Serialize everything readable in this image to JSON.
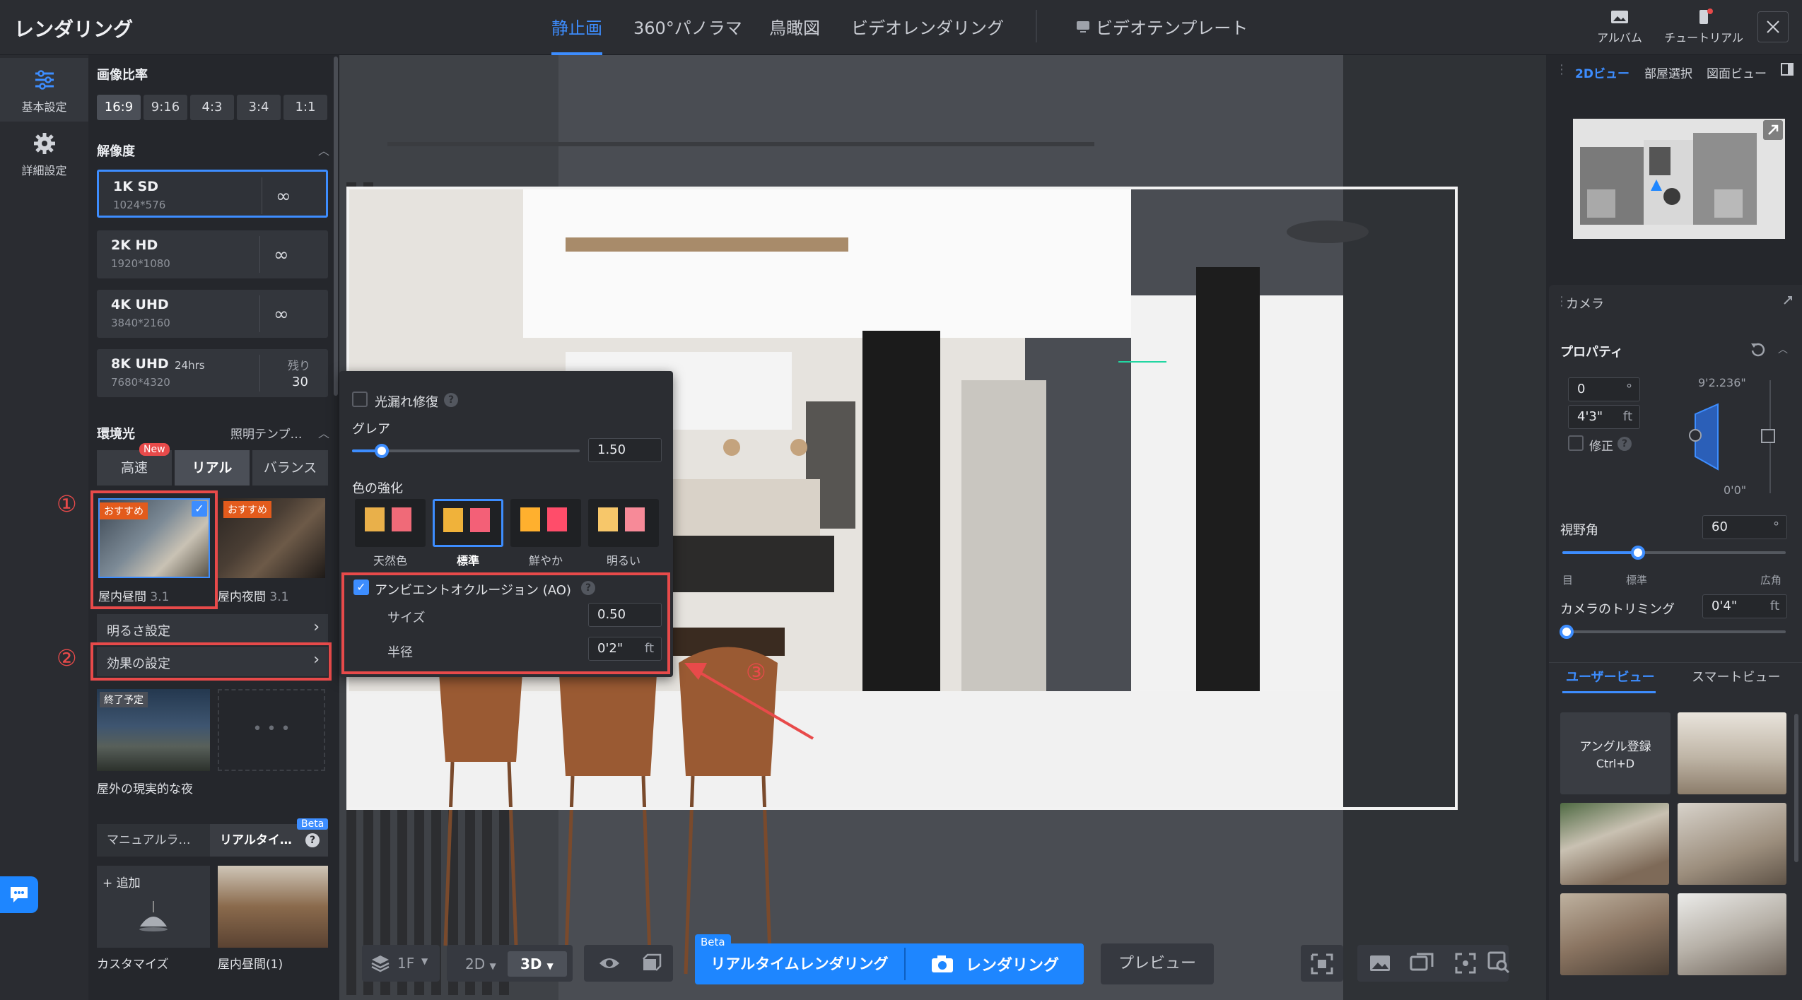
{
  "app": {
    "title": "レンダリング"
  },
  "top_tabs": [
    {
      "label": "静止画",
      "active": true
    },
    {
      "label": "360°パノラマ"
    },
    {
      "label": "鳥瞰図"
    },
    {
      "label": "ビデオレンダリング"
    },
    {
      "label": "ビデオテンプレート"
    }
  ],
  "top_right": {
    "album": "アルバム",
    "tutorial": "チュートリアル"
  },
  "left_nav": {
    "basic": "基本設定",
    "advanced": "詳細設定"
  },
  "aspect": {
    "title": "画像比率",
    "options": [
      "16:9",
      "9:16",
      "4:3",
      "3:4",
      "1:1"
    ],
    "selected": "16:9"
  },
  "resolution": {
    "title": "解像度",
    "options": [
      {
        "name": "1K SD",
        "size": "1024*576",
        "right": "∞",
        "selected": true
      },
      {
        "name": "2K HD",
        "size": "1920*1080",
        "right": "∞"
      },
      {
        "name": "4K UHD",
        "size": "3840*2160",
        "right": "∞"
      },
      {
        "name": "8K UHD",
        "tag": "24hrs",
        "size": "7680*4320",
        "remaining_label": "残り",
        "remaining": "30"
      }
    ]
  },
  "ambient": {
    "title": "環境光",
    "template": "照明テンプ…",
    "modes": [
      "高速",
      "リアル",
      "バランス"
    ],
    "new_badge": "New",
    "selected_mode": "リアル",
    "presets": [
      {
        "badge": "おすすめ",
        "name": "屋内昼間",
        "version": "3.1",
        "selected": true
      },
      {
        "badge": "おすすめ",
        "name": "屋内夜間",
        "version": "3.1"
      }
    ],
    "brightness": "明るさ設定",
    "effects": "効果の設定",
    "outdoor": {
      "badge": "終了予定",
      "name": "屋外の現実的な夜"
    }
  },
  "lights": {
    "tabs": [
      "マニュアルラ…",
      "リアルタイ…"
    ],
    "beta": "Beta",
    "add": "+ 追加",
    "items": [
      "カスタマイズ",
      "屋内昼間(1)"
    ]
  },
  "callouts": [
    "①",
    "②",
    "③"
  ],
  "effects_popup": {
    "light_leak": "光漏れ修復",
    "glare_label": "グレア",
    "glare_value": "1.50",
    "glare_level": 0.13,
    "color_title": "色の強化",
    "color_options": [
      "天然色",
      "標準",
      "鮮やか",
      "明るい"
    ],
    "color_selected": "標準",
    "ao_label": "アンビエントオクルージョン (AO)",
    "ao_checked": true,
    "size_label": "サイズ",
    "size_value": "0.50",
    "radius_label": "半径",
    "radius_value": "0'2\"",
    "radius_unit": "ft"
  },
  "bottom_toolbar": {
    "floor": "1F",
    "view2d": "2D",
    "view3d": "3D",
    "beta": "Beta",
    "realtime": "リアルタイムレンダリング",
    "render": "レンダリング",
    "preview": "プレビュー"
  },
  "right_panel": {
    "tabs": [
      "2Dビュー",
      "部屋選択",
      "図面ビュー"
    ],
    "camera_title": "カメラ",
    "properties": "プロパティ",
    "angle_value": "0",
    "angle_unit": "°",
    "height_value": "4'3\"",
    "height_unit": "ft",
    "fix_label": "修正",
    "dim_top": "9'2.236\"",
    "dim_bottom": "0'0\"",
    "fov_label": "視野角",
    "fov_value": "60",
    "fov_unit": "°",
    "fov_level": 0.34,
    "fov_marks": [
      "目",
      "標準",
      "広角"
    ],
    "trim_label": "カメラのトリミング",
    "trim_value": "0'4\"",
    "trim_unit": "ft",
    "view_tabs": [
      "ユーザービュー",
      "スマートビュー"
    ],
    "angle_save": "アングル登録",
    "shortcut": "Ctrl+D"
  }
}
